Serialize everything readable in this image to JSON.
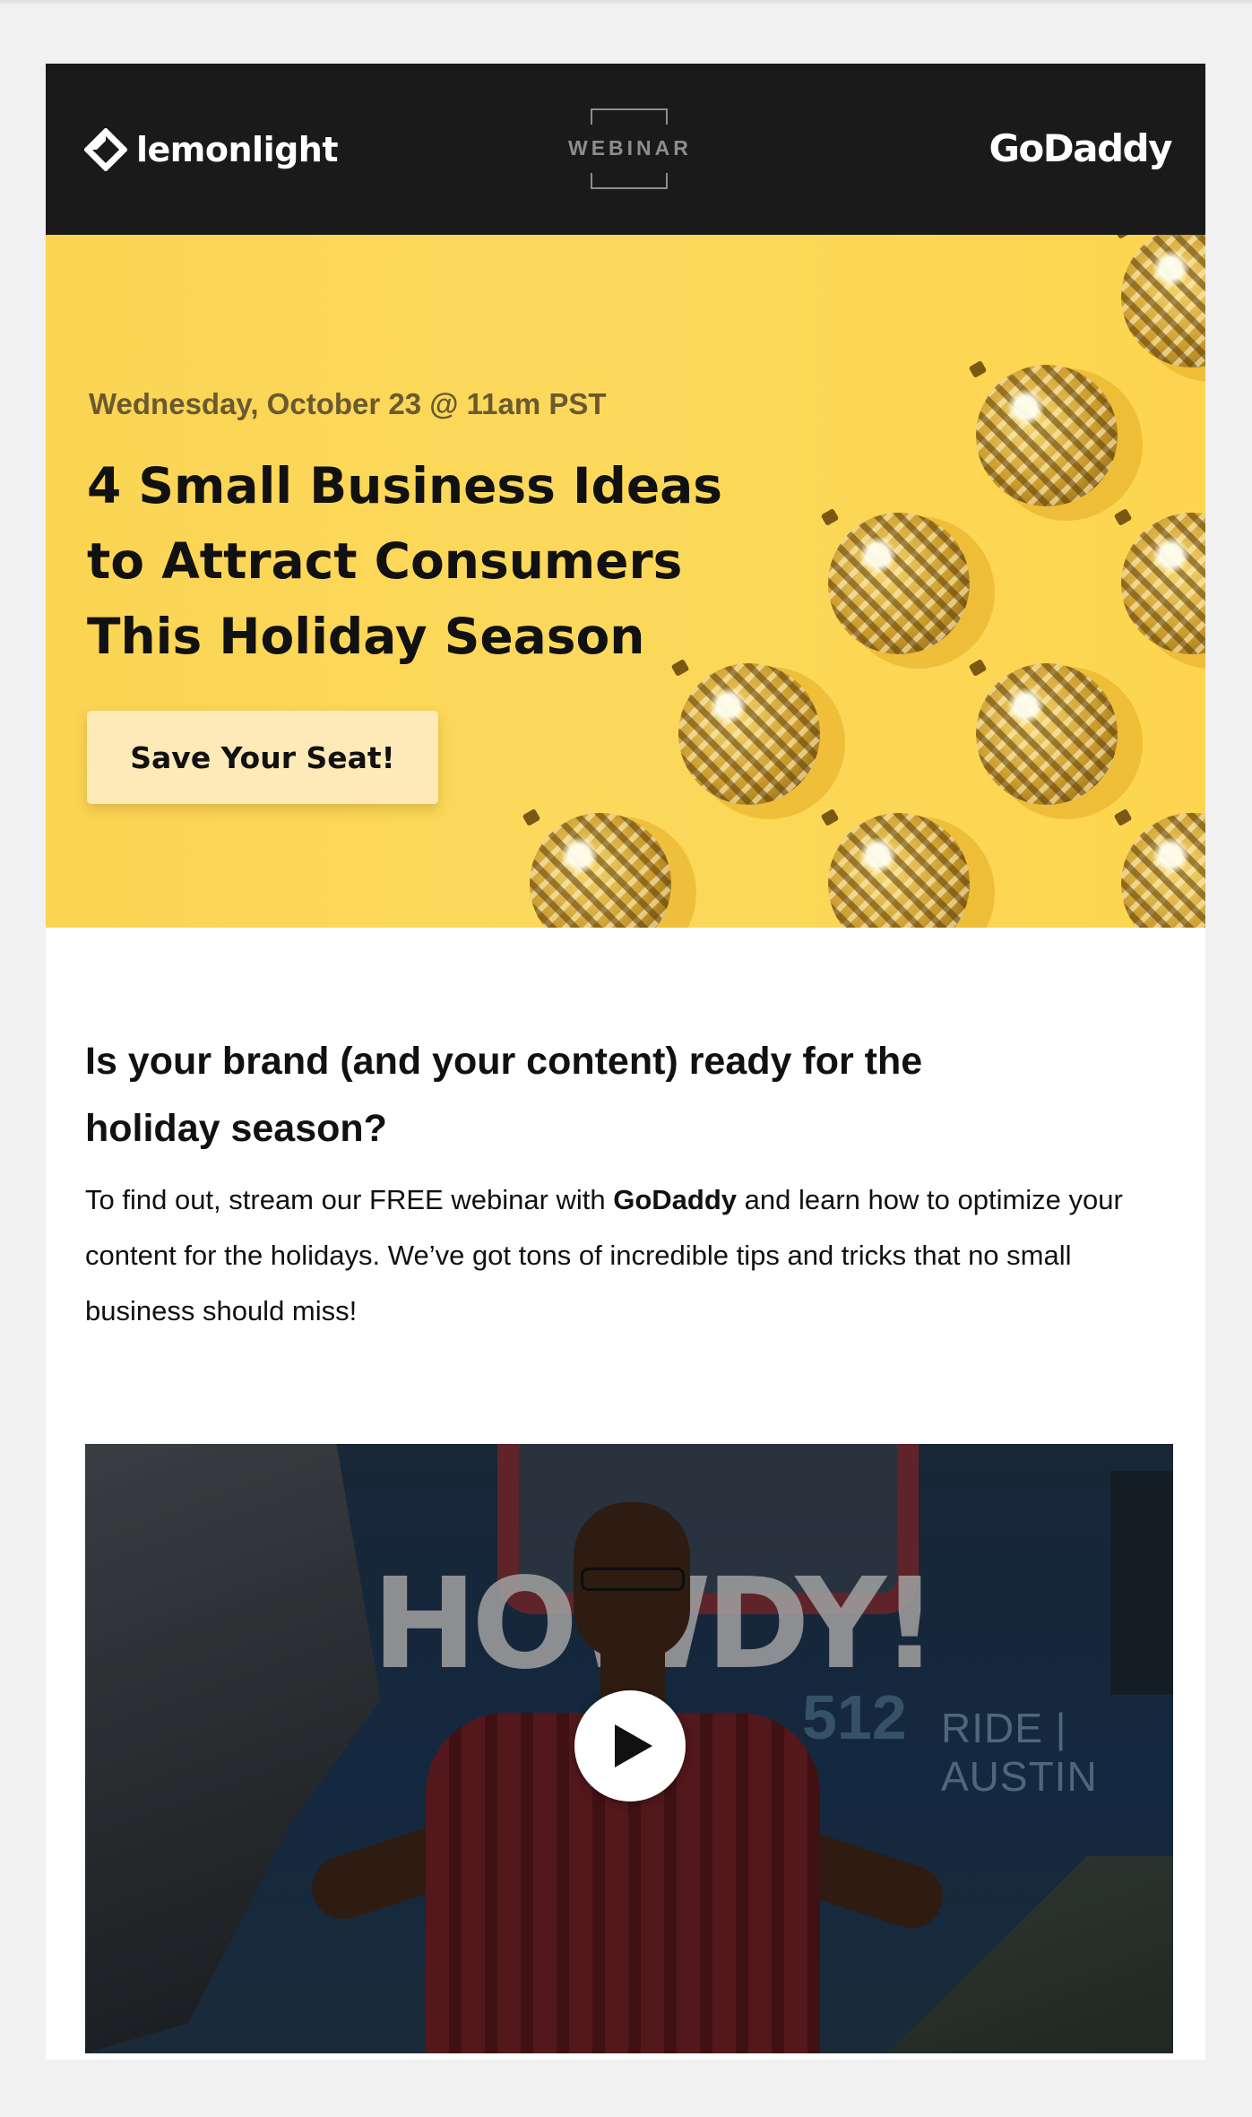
{
  "header": {
    "brand_left": "lemonlight",
    "webinar_label": "WEBINAR",
    "brand_right": "GoDaddy"
  },
  "hero": {
    "date_line": "Wednesday, October 23 @ 11am PST",
    "title_lines": [
      "4 Small Business Ideas",
      "to Attract Consumers",
      "This Holiday Season"
    ],
    "cta_label": "Save Your Seat!",
    "background_color": "#fcd95c",
    "icons": [
      "disco-ball-ornament-icon"
    ]
  },
  "content": {
    "headline_lines": [
      "Is your brand (and your content) ready for the",
      "holiday season?"
    ],
    "paragraph": {
      "before_bold": "To find out, stream our FREE webinar with ",
      "bold": "GoDaddy",
      "after_bold_line1": " and learn how to optimize your",
      "line2": "content for the holidays. We’ve got tons of incredible tips and tricks that no small",
      "line3": "business should miss!"
    }
  },
  "video": {
    "mural_text": "HOWDY!",
    "mural_number": "512",
    "mural_sign": "RIDE | AUSTIN",
    "play_icon": "play-icon"
  }
}
